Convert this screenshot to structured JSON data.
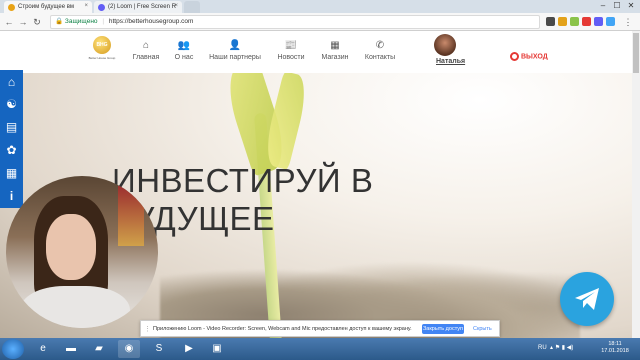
{
  "browser": {
    "tabs": [
      {
        "title": "Строим будущее вм",
        "favicon_color": "#e8a317",
        "active": true
      },
      {
        "title": "(2) Loom | Free Screen R",
        "favicon_color": "#625df5",
        "active": false
      }
    ],
    "url_secure_label": "Защищено",
    "url": "https://betterhousegroup.com",
    "window_buttons": {
      "minimize": "–",
      "maximize": "☐",
      "close": "✕"
    }
  },
  "site": {
    "logo_text": "BHG",
    "logo_caption": "Better House Group",
    "nav": [
      {
        "label": "Главная",
        "icon": "home-icon",
        "glyph": "⌂"
      },
      {
        "label": "О нас",
        "icon": "people-icon",
        "glyph": "👥"
      },
      {
        "label": "Наши партнеры",
        "icon": "person-icon",
        "glyph": "👤"
      },
      {
        "label": "Новости",
        "icon": "news-icon",
        "glyph": "📰"
      },
      {
        "label": "Магазин",
        "icon": "shop-icon",
        "glyph": "▦"
      },
      {
        "label": "Контакты",
        "icon": "phone-icon",
        "glyph": "✆"
      }
    ],
    "user_name": "Наталья",
    "logout_label": "ВЫХОД",
    "hero_line1": "ИНВЕСТИРУЙ В",
    "hero_line2": "БУДУЩЕЕ"
  },
  "sidebar_icons": [
    "house-icon",
    "brain-icon",
    "clipboard-icon",
    "mickey-icon",
    "calendar-icon",
    "info-icon"
  ],
  "sidebar_glyphs": [
    "⌂",
    "☯",
    "▤",
    "✿",
    "▦",
    "i"
  ],
  "share_notice": {
    "text": "Приложению Loom - Video Recorder: Screen, Webcam and Mic предоставлен доступ к вашему экрану.",
    "stop_label": "Закрыть доступ",
    "hide_label": "Скрыть"
  },
  "taskbar": {
    "lang": "RU",
    "time": "18:11",
    "date": "17.01.2018"
  },
  "colors": {
    "accent_blue": "#1565c0",
    "logout_red": "#e53935",
    "telegram": "#2aa3df"
  }
}
